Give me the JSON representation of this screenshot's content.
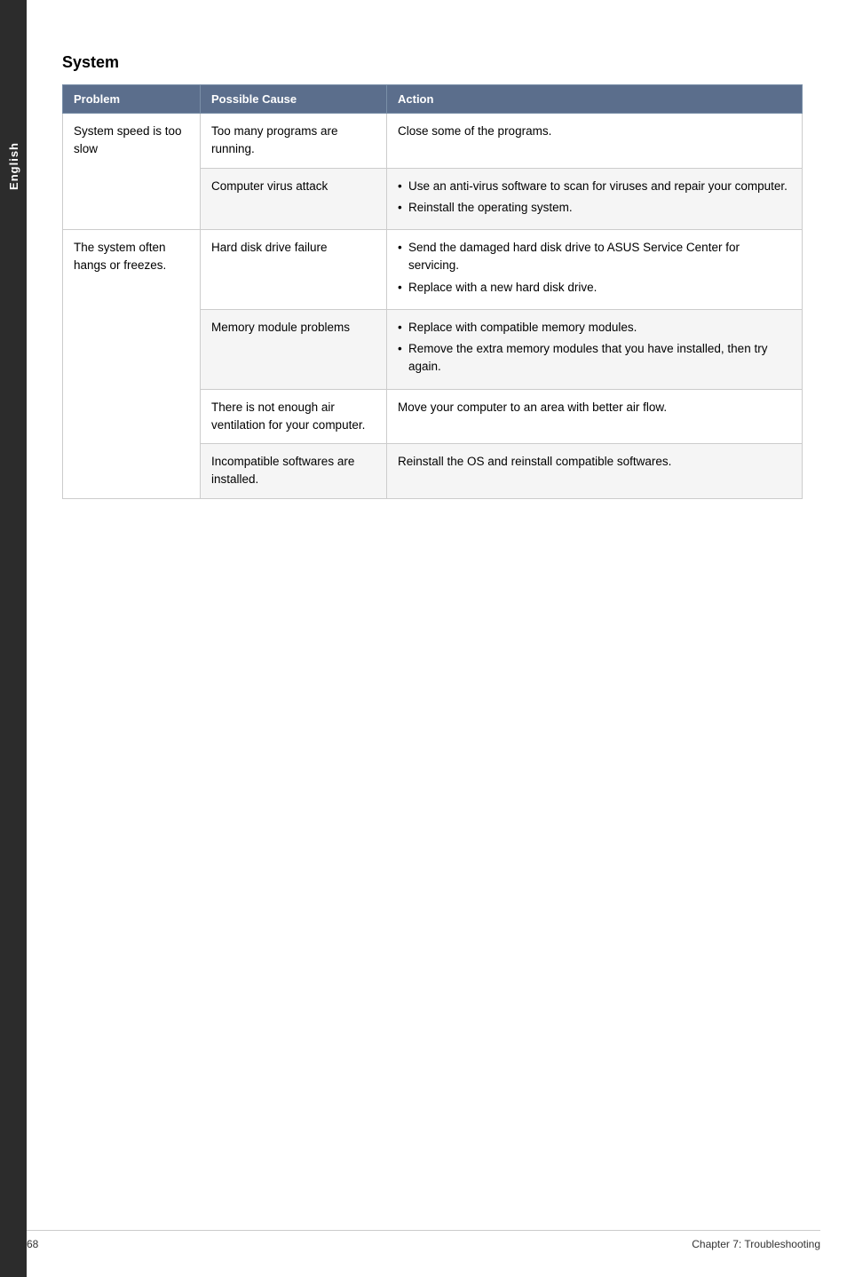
{
  "sidebar": {
    "label": "English"
  },
  "section": {
    "title": "System"
  },
  "table": {
    "headers": {
      "problem": "Problem",
      "cause": "Possible Cause",
      "action": "Action"
    },
    "rows": [
      {
        "problem": "System speed is too slow",
        "cause": "Too many programs are running.",
        "action_type": "text",
        "action": "Close some of the programs.",
        "problem_rowspan": 2,
        "cause_rowspan": 1
      },
      {
        "problem": "",
        "cause": "Computer virus attack",
        "action_type": "bullets",
        "action_items": [
          "Use an anti-virus software to scan for viruses and repair your computer.",
          "Reinstall the operating system."
        ],
        "problem_rowspan": 0,
        "cause_rowspan": 1
      },
      {
        "problem": "The system often hangs or freezes.",
        "cause": "Hard disk drive failure",
        "action_type": "bullets",
        "action_items": [
          "Send the damaged hard disk drive to ASUS Service Center for servicing.",
          "Replace with a new hard disk drive."
        ],
        "problem_rowspan": 4,
        "cause_rowspan": 1
      },
      {
        "problem": "",
        "cause": "Memory module problems",
        "action_type": "bullets",
        "action_items": [
          "Replace with compatible memory modules.",
          "Remove the extra memory modules that you have installed, then try again."
        ],
        "problem_rowspan": 0,
        "cause_rowspan": 1
      },
      {
        "problem": "",
        "cause": "There is not enough air ventilation for your computer.",
        "action_type": "text",
        "action": "Move your computer to an area with better air flow.",
        "problem_rowspan": 0,
        "cause_rowspan": 1
      },
      {
        "problem": "",
        "cause": "Incompatible softwares are installed.",
        "action_type": "text",
        "action": "Reinstall the OS and reinstall compatible softwares.",
        "problem_rowspan": 0,
        "cause_rowspan": 1
      }
    ]
  },
  "footer": {
    "page_number": "68",
    "chapter": "Chapter 7: Troubleshooting"
  }
}
